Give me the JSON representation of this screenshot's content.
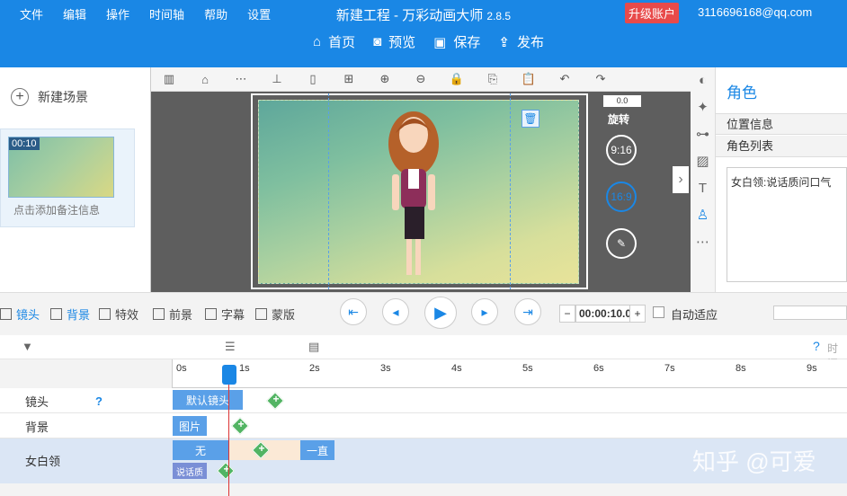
{
  "menu": [
    "文件",
    "编辑",
    "操作",
    "时间轴",
    "帮助",
    "设置"
  ],
  "app": {
    "title": "新建工程 - 万彩动画大师",
    "version": "2.8.5",
    "upgrade": "升级账户",
    "email": "3116696168@qq.com"
  },
  "topbuttons": [
    {
      "icon": "home-icon",
      "label": "首页"
    },
    {
      "icon": "preview-icon",
      "label": "预览"
    },
    {
      "icon": "save-icon",
      "label": "保存"
    },
    {
      "icon": "publish-icon",
      "label": "发布"
    }
  ],
  "leftpanel": {
    "new_scene": "新建场景",
    "scene_time": "00:10",
    "scene_note": "点击添加备注信息"
  },
  "canvas": {
    "rotate_value": "0.0",
    "rotate_label": "旋转",
    "ratio1": "9:16",
    "ratio2": "16:9"
  },
  "rightpanel": {
    "title": "角色",
    "position_info": "位置信息",
    "role_list": "角色列表",
    "role_item": "女白领:说话质问口气"
  },
  "bottomtabs": [
    "镜头",
    "背景",
    "特效",
    "前景",
    "字幕",
    "蒙版"
  ],
  "timecode": "00:00:10.0",
  "auto_fit": "自动适应",
  "ruler": [
    "0s",
    "1s",
    "2s",
    "3s",
    "4s",
    "5s",
    "6s",
    "7s",
    "8s",
    "9s"
  ],
  "tracks": {
    "camera": "镜头",
    "background": "背景",
    "actor": "女白领"
  },
  "blocks": {
    "camera_block": "默认镜头",
    "background_block": "图片",
    "actor_none": "无",
    "actor_always": "一直",
    "actor_speech": "说话质"
  },
  "help_label": "时间",
  "watermark": "知乎 @可爱"
}
